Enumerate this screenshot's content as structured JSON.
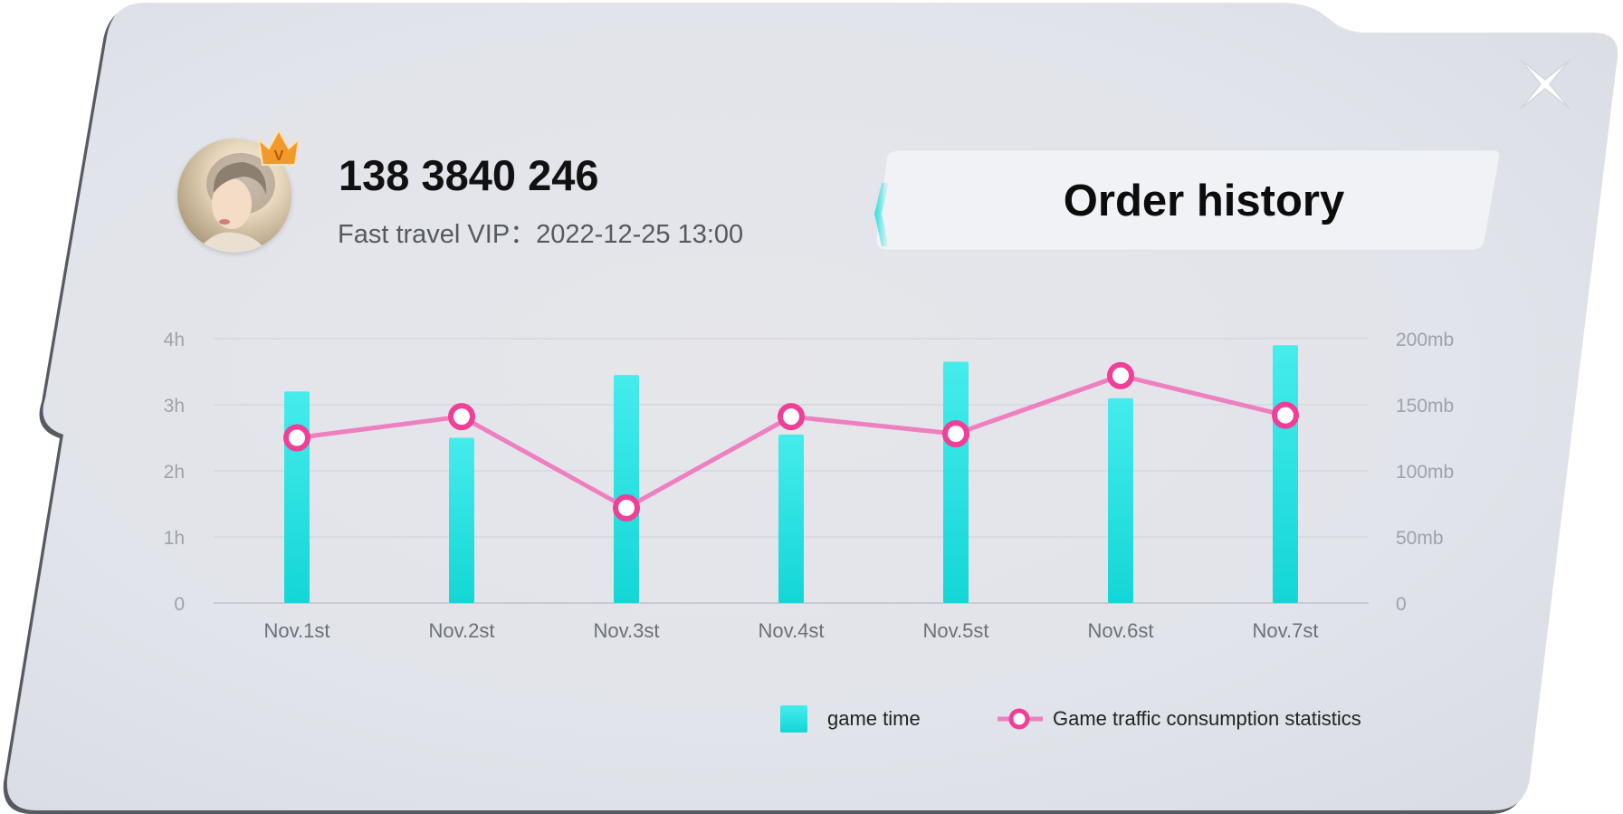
{
  "profile": {
    "phone": "138 3840 246",
    "vip_text": "Fast travel VIP：2022-12-25 13:00",
    "badge_letter": "V"
  },
  "order_history_label": "Order history",
  "colors": {
    "panel": "#e2e4ea",
    "accent_cyan": "#2fe3e3",
    "line_pink": "#ee7fc0",
    "marker_pink": "#ef3f97",
    "crown_orange": "#f19a2b"
  },
  "chart_data": {
    "type": "bar+line",
    "categories": [
      "Nov.1st",
      "Nov.2st",
      "Nov.3st",
      "Nov.4st",
      "Nov.5st",
      "Nov.6st",
      "Nov.7st"
    ],
    "left_axis": {
      "ticks": [
        "0",
        "1h",
        "2h",
        "3h",
        "4h"
      ],
      "ylim": [
        0,
        4
      ],
      "unit": "h"
    },
    "right_axis": {
      "ticks": [
        "0",
        "50mb",
        "100mb",
        "150mb",
        "200mb"
      ],
      "ylim": [
        0,
        200
      ],
      "unit": "mb"
    },
    "series": [
      {
        "name": "game time",
        "type": "bar",
        "axis": "left",
        "values": [
          3.2,
          2.5,
          3.45,
          2.55,
          3.65,
          3.1,
          3.9
        ]
      },
      {
        "name": "Game traffic consumption statistics",
        "type": "line",
        "axis": "right",
        "values": [
          125,
          141,
          72,
          141,
          128,
          172,
          142
        ]
      }
    ],
    "grid": true,
    "legend_position": "bottom-right"
  }
}
